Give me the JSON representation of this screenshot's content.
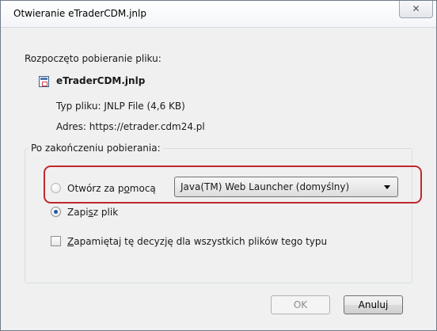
{
  "window": {
    "title": "Otwieranie eTraderCDM.jnlp",
    "close_glyph": "✕"
  },
  "download": {
    "intro": "Rozpoczęto pobieranie pliku:",
    "file_icon": "jnlp-file-icon",
    "file_name": "eTraderCDM.jnlp",
    "type_line": "Typ pliku: JNLP File (4,6 KB)",
    "address_line": "Adres: https://etrader.cdm24.pl"
  },
  "after_download": {
    "group_label": "Po zakończeniu pobierania:",
    "open_with_label": "Otwórz za pomocą",
    "open_with_selected": false,
    "open_with_app": "Java(TM) Web Launcher (domyślny)",
    "save_file_label": "Zapisz plik",
    "save_file_selected": true,
    "remember_label": "Zapamiętaj tę decyzję dla wszystkich plików tego typu",
    "remember_checked": false,
    "highlight_color": "#c0282e"
  },
  "buttons": {
    "ok_label": "OK",
    "ok_enabled": false,
    "cancel_label": "Anuluj"
  }
}
